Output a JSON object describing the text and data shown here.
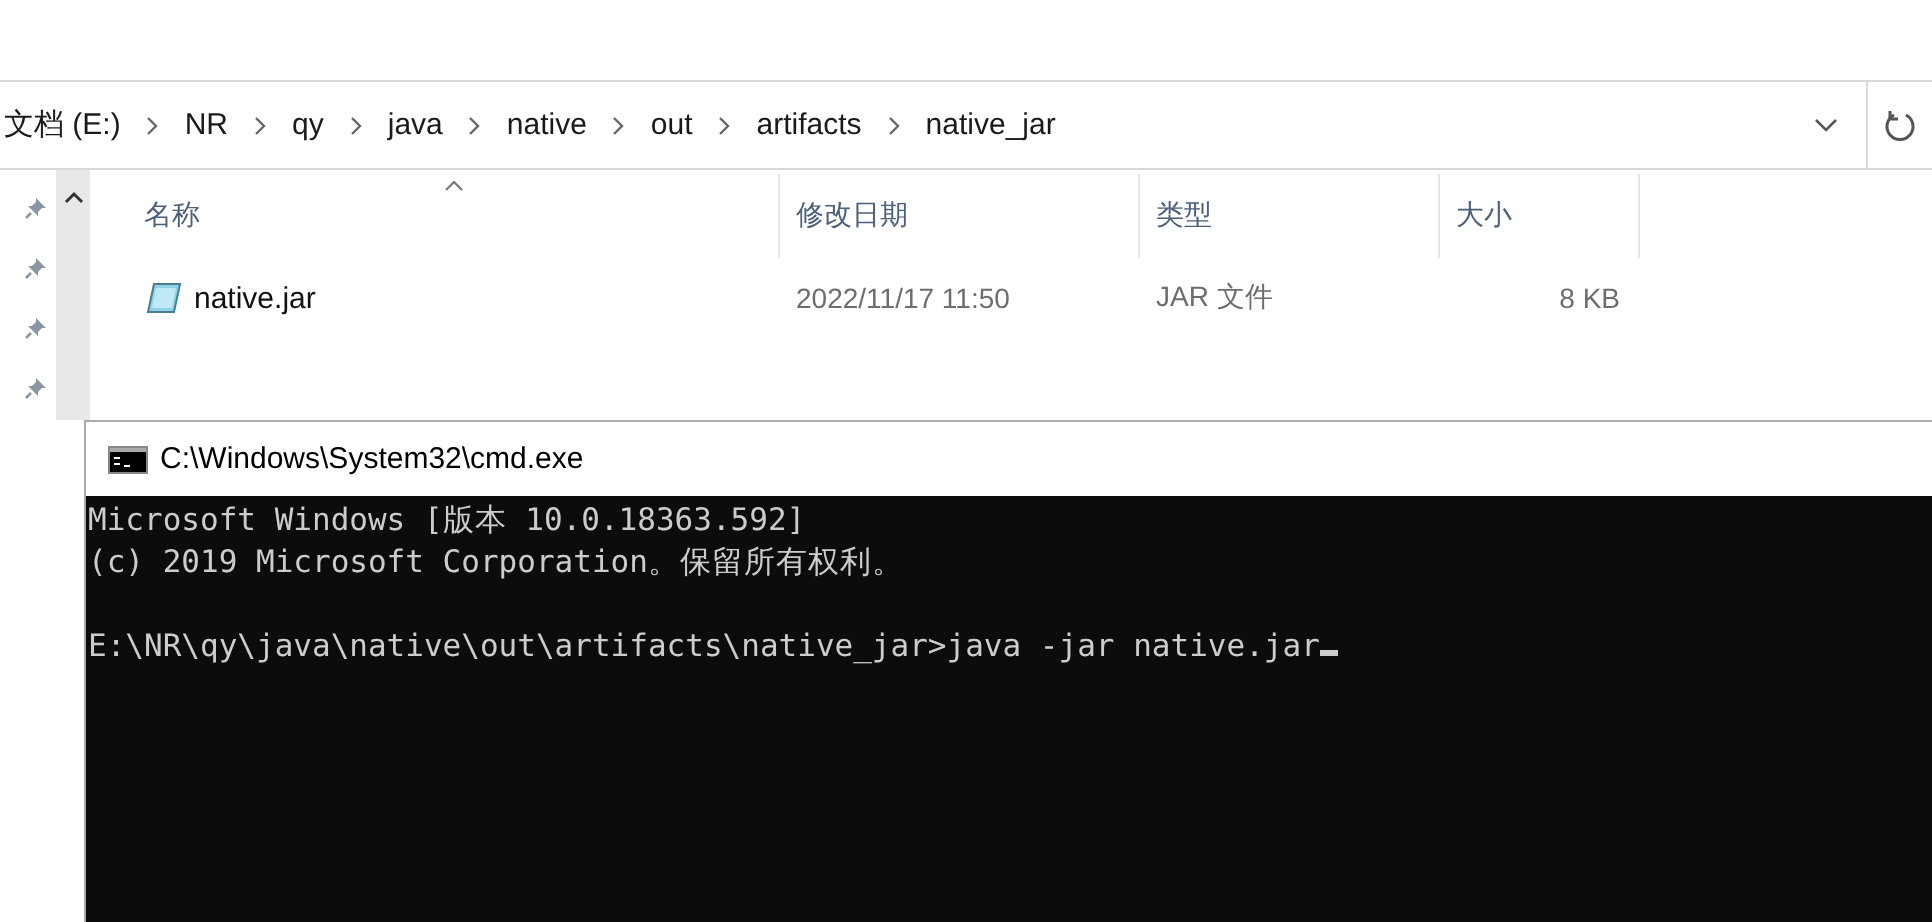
{
  "address_bar": {
    "crumbs": [
      "文档 (E:)",
      "NR",
      "qy",
      "java",
      "native",
      "out",
      "artifacts",
      "native_jar"
    ]
  },
  "columns": [
    {
      "label": "名称",
      "sorted": true
    },
    {
      "label": "修改日期",
      "sorted": false
    },
    {
      "label": "类型",
      "sorted": false
    },
    {
      "label": "大小",
      "sorted": false
    }
  ],
  "files": [
    {
      "name": "native.jar",
      "modified": "2022/11/17 11:50",
      "type": "JAR 文件",
      "size": "8 KB"
    }
  ],
  "console": {
    "title": "C:\\Windows\\System32\\cmd.exe",
    "blocks": [
      [
        "Microsoft Windows [版本 10.0.18363.592]",
        "(c) 2019 Microsoft Corporation。保留所有权利。"
      ],
      [
        "E:\\NR\\qy\\java\\native\\out\\artifacts\\native_jar>java -jar native.jar"
      ]
    ]
  }
}
